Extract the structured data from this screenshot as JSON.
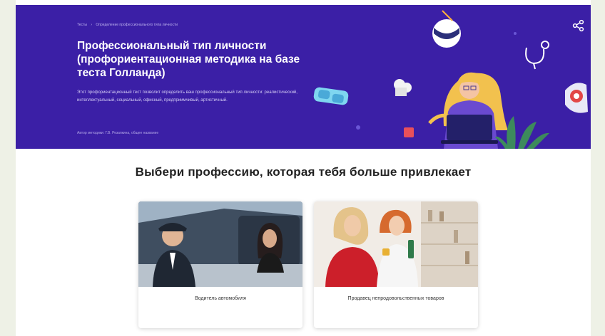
{
  "breadcrumbs": [
    "Тесты",
    "Определение профессионального типа личности"
  ],
  "hero": {
    "title": "Профессиональный тип личности (профориентационная методика на базе теста Голланда)",
    "description": "Этот профориентационный тест позволит определить ваш профессиональный тип личности: реалистический, интеллектуальный, социальный, офисный, предприимчивый, артистичный.",
    "author": "Автор методики: Г.В. Резапкина, общее название",
    "background_color": "#3b1fa6",
    "share_icon": "share-icon"
  },
  "question": "Выбери профессию, которая тебя больше привлекает",
  "cards": [
    {
      "label": "Водитель автомобиля"
    },
    {
      "label": "Продавец непродовольственных товаров"
    }
  ]
}
